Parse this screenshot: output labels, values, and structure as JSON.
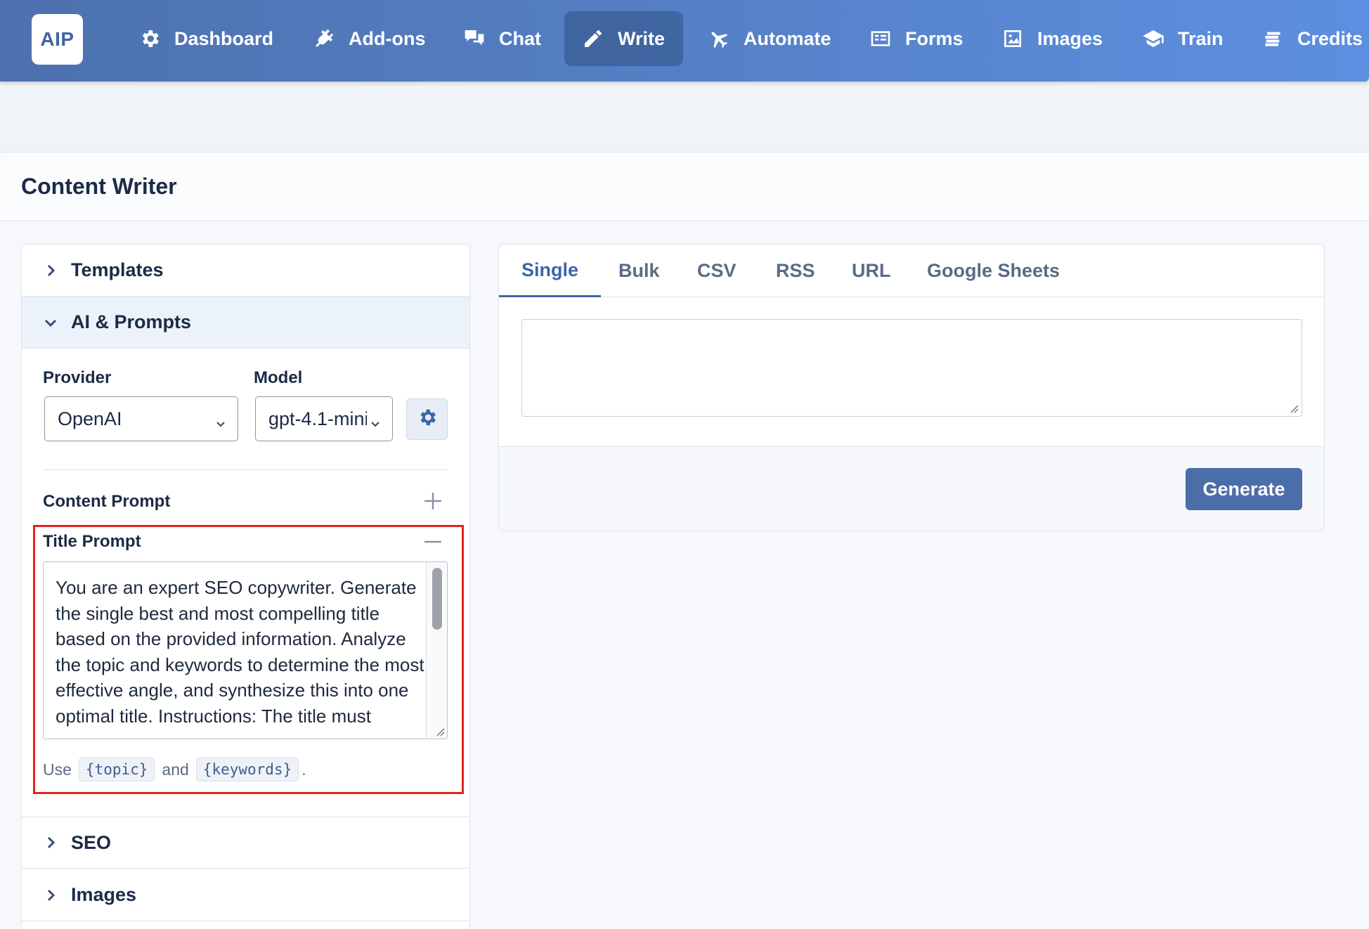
{
  "app": {
    "logo_text": "AIP"
  },
  "nav": {
    "items": [
      {
        "label": "Dashboard",
        "icon": "gear-icon"
      },
      {
        "label": "Add-ons",
        "icon": "plug-icon"
      },
      {
        "label": "Chat",
        "icon": "chat-icon"
      },
      {
        "label": "Write",
        "icon": "pencil-icon",
        "active": true
      },
      {
        "label": "Automate",
        "icon": "plane-icon"
      },
      {
        "label": "Forms",
        "icon": "form-icon"
      },
      {
        "label": "Images",
        "icon": "image-icon"
      },
      {
        "label": "Train",
        "icon": "graduation-cap-icon"
      },
      {
        "label": "Credits",
        "icon": "coins-icon"
      }
    ]
  },
  "page": {
    "title": "Content Writer"
  },
  "sidebar": {
    "sections": [
      {
        "label": "Templates",
        "expanded": false
      },
      {
        "label": "AI & Prompts",
        "expanded": true
      },
      {
        "label": "SEO",
        "expanded": false
      },
      {
        "label": "Images",
        "expanded": false
      }
    ],
    "provider": {
      "label": "Provider",
      "value": "OpenAI"
    },
    "model": {
      "label": "Model",
      "value": "gpt-4.1-mini"
    },
    "content_prompt": {
      "label": "Content Prompt"
    },
    "title_prompt": {
      "label": "Title Prompt",
      "value": "You are an expert SEO copywriter. Generate the single best and most compelling title based on the provided information. Analyze the topic and keywords to determine the most effective angle, and synthesize this into one optimal title. Instructions: The title must"
    },
    "hint": {
      "prefix": "Use",
      "var1": "{topic}",
      "conj": "and",
      "var2": "{keywords}",
      "suffix": "."
    }
  },
  "editor": {
    "tabs": [
      "Single",
      "Bulk",
      "CSV",
      "RSS",
      "URL",
      "Google Sheets"
    ],
    "active_tab": "Single",
    "topic_value": "",
    "generate_label": "Generate"
  },
  "colors": {
    "nav_gradient_start": "#4d71ae",
    "nav_gradient_end": "#5d8fe0",
    "accent": "#3d66a6",
    "highlight": "#e0261e"
  }
}
